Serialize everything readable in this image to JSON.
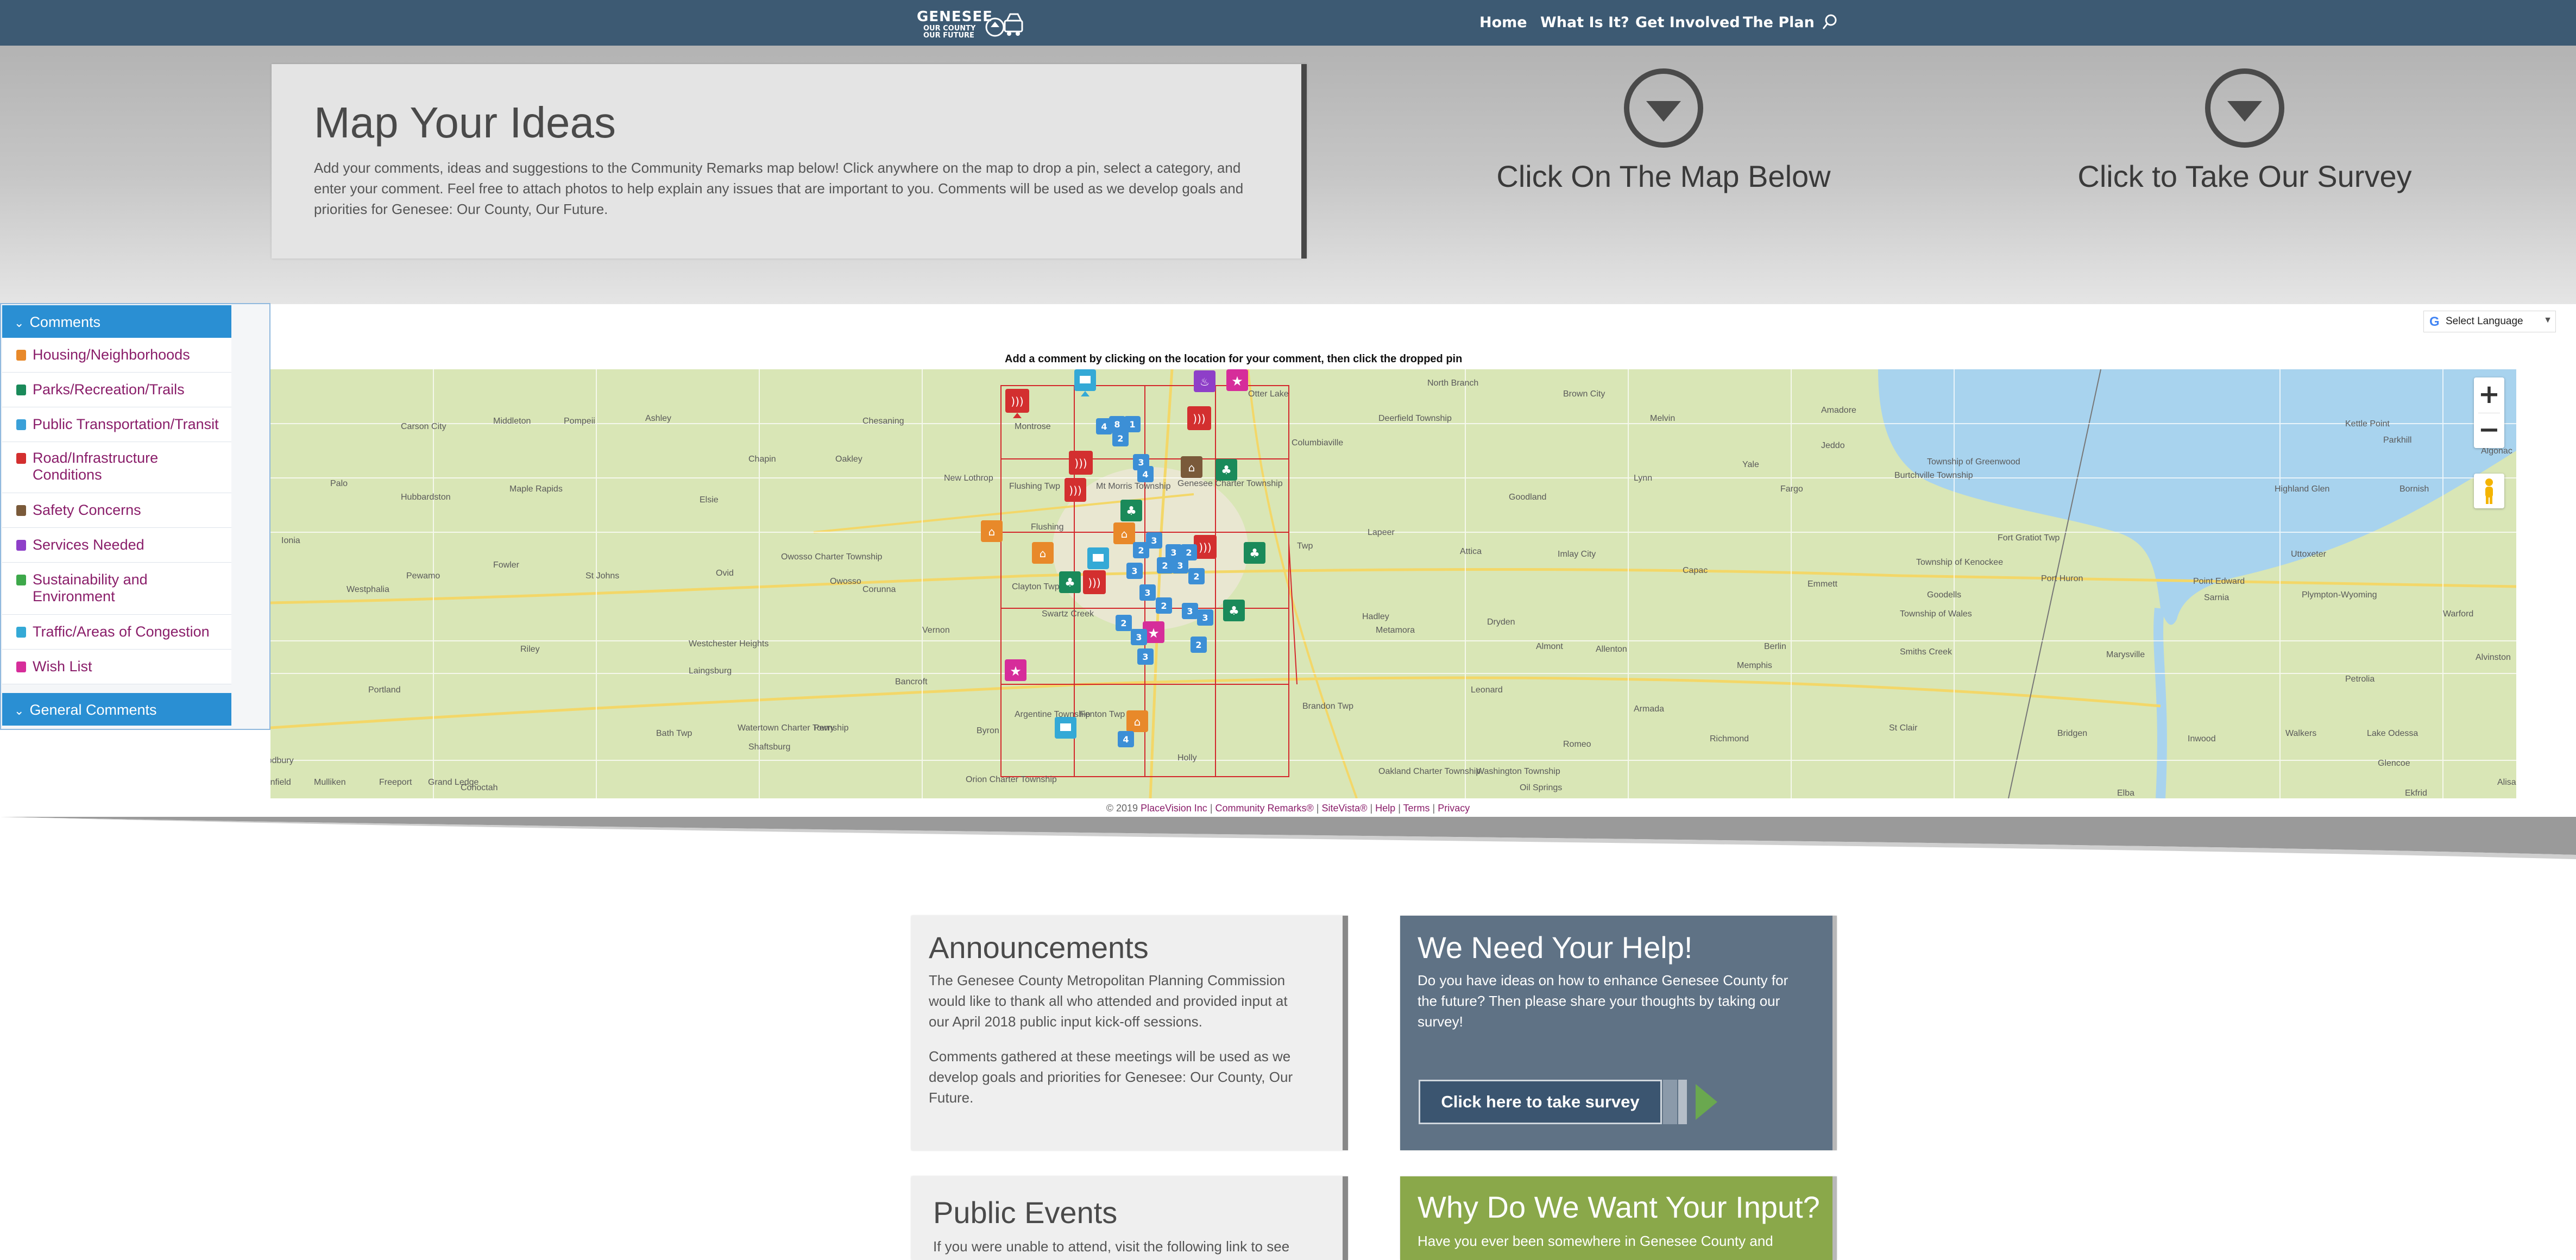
{
  "header": {
    "logo": {
      "line1": "GENESEE",
      "line2": "OUR COUNTY",
      "line3": "OUR FUTURE"
    },
    "nav": [
      "Home",
      "What Is It?",
      "Get Involved",
      "The Plan"
    ]
  },
  "hero": {
    "title": "Map Your Ideas",
    "text": "Add your comments, ideas and suggestions to the Community Remarks map below! Click anywhere on the map to drop a pin, select a category, and enter your comment. Feel free to attach photos to help explain any issues that are important to you. Comments will be used as we develop goals and priorities for Genesee: Our County, Our Future.",
    "cta_map": "Click On The Map Below",
    "cta_survey": "Click to Take Our Survey"
  },
  "language": {
    "label": "Select Language"
  },
  "map": {
    "instruction": "Add a comment by clicking on the location for your comment, then click the dropped pin",
    "zoom_in": "+",
    "zoom_out": "−",
    "places": [
      {
        "name": "North Branch"
      },
      {
        "name": "Brown City"
      },
      {
        "name": "Amadore"
      },
      {
        "name": "Kettle Point"
      },
      {
        "name": "Carson City"
      },
      {
        "name": "Middleton"
      },
      {
        "name": "Pompeii"
      },
      {
        "name": "Ashley"
      },
      {
        "name": "Chesaning"
      },
      {
        "name": "Montrose"
      },
      {
        "name": "Otter Lake"
      },
      {
        "name": "Columbiaville"
      },
      {
        "name": "Deerfield Township"
      },
      {
        "name": "Melvin"
      },
      {
        "name": "Jeddo"
      },
      {
        "name": "Parkhill"
      },
      {
        "name": "Chapin"
      },
      {
        "name": "Oakley"
      },
      {
        "name": "New Lothrop"
      },
      {
        "name": "Flushing Twp"
      },
      {
        "name": "Mt Morris Township"
      },
      {
        "name": "Genesee Charter Township"
      },
      {
        "name": "Lynn"
      },
      {
        "name": "Yale"
      },
      {
        "name": "Township of Greenwood"
      },
      {
        "name": "Burtchville Township"
      },
      {
        "name": "Highland Glen"
      },
      {
        "name": "Bornish"
      },
      {
        "name": "Palo"
      },
      {
        "name": "Hubbardston"
      },
      {
        "name": "Maple Rapids"
      },
      {
        "name": "Elsie"
      },
      {
        "name": "Goodland"
      },
      {
        "name": "Fargo"
      },
      {
        "name": "Fort Gratiot Twp"
      },
      {
        "name": "Uttoxeter"
      },
      {
        "name": "Ionia"
      },
      {
        "name": "Pewamo"
      },
      {
        "name": "Fowler"
      },
      {
        "name": "St Johns"
      },
      {
        "name": "Ovid"
      },
      {
        "name": "Owosso Charter Township"
      },
      {
        "name": "Owosso"
      },
      {
        "name": "Corunna"
      },
      {
        "name": "Flushing"
      },
      {
        "name": "Clayton Twp"
      },
      {
        "name": "Lapeer"
      },
      {
        "name": "Attica"
      },
      {
        "name": "Imlay City"
      },
      {
        "name": "Capac"
      },
      {
        "name": "Township of Kenockee"
      },
      {
        "name": "Emmett"
      },
      {
        "name": "Goodells"
      },
      {
        "name": "Port Huron"
      },
      {
        "name": "Point Edward"
      },
      {
        "name": "Sarnia"
      },
      {
        "name": "Plympton-Wyoming"
      },
      {
        "name": "Warford"
      },
      {
        "name": "Township of Wales"
      },
      {
        "name": "Westphalia"
      },
      {
        "name": "Riley"
      },
      {
        "name": "Westchester Heights"
      },
      {
        "name": "Vernon"
      },
      {
        "name": "Swartz Creek"
      },
      {
        "name": "Hadley"
      },
      {
        "name": "Metamora"
      },
      {
        "name": "Dryden"
      },
      {
        "name": "Almont"
      },
      {
        "name": "Allenton"
      },
      {
        "name": "Berlin"
      },
      {
        "name": "Memphis"
      },
      {
        "name": "Smiths Creek"
      },
      {
        "name": "Marysville"
      },
      {
        "name": "Petrolia"
      },
      {
        "name": "Alvinston"
      },
      {
        "name": "Portland"
      },
      {
        "name": "Laingsburg"
      },
      {
        "name": "Bancroft"
      },
      {
        "name": "Leonard"
      },
      {
        "name": "Armada"
      },
      {
        "name": "Brandon Twp"
      },
      {
        "name": "Argentine Township"
      },
      {
        "name": "Fenton Twp"
      },
      {
        "name": "Byron"
      },
      {
        "name": "Perry"
      },
      {
        "name": "Bath Twp"
      },
      {
        "name": "Watertown Charter Township"
      },
      {
        "name": "Shaftsburg"
      },
      {
        "name": "Holly"
      },
      {
        "name": "Romeo"
      },
      {
        "name": "Richmond"
      },
      {
        "name": "St Clair"
      },
      {
        "name": "Bridgen"
      },
      {
        "name": "Inwood"
      },
      {
        "name": "Walkers"
      },
      {
        "name": "Lake Odessa"
      },
      {
        "name": "Woodbury"
      },
      {
        "name": "Sunfield"
      },
      {
        "name": "Mulliken"
      },
      {
        "name": "Freeport"
      },
      {
        "name": "Grand Ledge"
      },
      {
        "name": "Cohoctah"
      },
      {
        "name": "Orion Charter Township"
      },
      {
        "name": "Oakland Charter Township"
      },
      {
        "name": "Washington Township"
      },
      {
        "name": "Oil Springs"
      },
      {
        "name": "Glencoe"
      },
      {
        "name": "Ekfrid"
      },
      {
        "name": "Alisa Craig"
      },
      {
        "name": "Algonac"
      },
      {
        "name": "Elba"
      },
      {
        "name": "Twp"
      }
    ],
    "clusters": [
      "4",
      "8",
      "1",
      "2",
      "3",
      "4",
      "3",
      "2",
      "3",
      "2",
      "2",
      "3",
      "3",
      "2",
      "3",
      "2",
      "3",
      "3",
      "2",
      "3",
      "2",
      "3",
      "4"
    ]
  },
  "footer_map": {
    "copyright": "© 2019",
    "links": [
      "PlaceVision Inc",
      "Community Remarks®",
      "SiteVista®",
      "Help",
      "Terms",
      "Privacy"
    ]
  },
  "sidebar": {
    "header_comments": "Comments",
    "items": [
      {
        "label": "Housing/Neighborhoods",
        "color": "#e8892a"
      },
      {
        "label": "Parks/Recreation/Trails",
        "color": "#1a8a5a"
      },
      {
        "label": "Public Transportation/Transit",
        "color": "#3aa0d8"
      },
      {
        "label": "Road/Infrastructure Conditions",
        "color": "#d32f2f"
      },
      {
        "label": "Safety Concerns",
        "color": "#7a5a3a"
      },
      {
        "label": "Services Needed",
        "color": "#8e3fc8"
      },
      {
        "label": "Sustainability and Environment",
        "color": "#3da84a"
      },
      {
        "label": "Traffic/Areas of Congestion",
        "color": "#34a9d6"
      },
      {
        "label": "Wish List",
        "color": "#d62d9a"
      }
    ],
    "header_general": "General Comments"
  },
  "cards": {
    "announcements": {
      "title": "Announcements",
      "p1": "The Genesee County Metropolitan Planning Commission would like to thank all who attended and provided input at our April 2018 public input kick-off sessions.",
      "p2": "Comments gathered at these meetings will be used as we develop goals and priorities for Genesee: Our County, Our Future."
    },
    "help": {
      "title": "We Need Your Help!",
      "text": "Do you have ideas on how to enhance Genesee County for the future? Then please share your thoughts by taking our survey!",
      "button": "Click here to take survey"
    },
    "events": {
      "title": "Public Events",
      "text": "If you were unable to attend, visit the following link to see"
    },
    "why": {
      "title": "Why Do We Want Your Input?",
      "text": "Have you ever been somewhere in Genesee County and"
    }
  },
  "colors": {
    "header_bg": "#3d5a73",
    "accent_blue": "#2a8fd3",
    "link_purple": "#8a1e6a",
    "why_green": "#8aa84a",
    "help_slate": "#5f7285"
  }
}
